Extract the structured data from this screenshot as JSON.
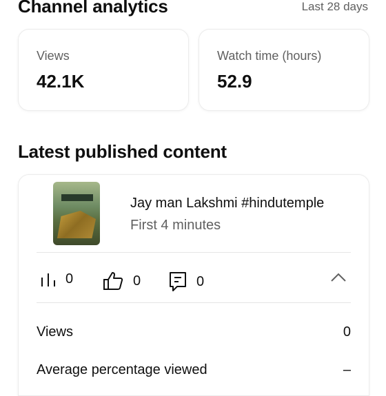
{
  "header": {
    "title": "Channel analytics",
    "range": "Last 28 days"
  },
  "stats": [
    {
      "label": "Views",
      "value": "42.1K"
    },
    {
      "label": "Watch time (hours)",
      "value": "52.9"
    }
  ],
  "latest": {
    "title": "Latest published content",
    "video": {
      "title": "Jay man Lakshmi #hindutemple",
      "subtitle": "First 4 minutes",
      "metrics": {
        "views": "0",
        "likes": "0",
        "comments": "0"
      },
      "details": [
        {
          "label": "Views",
          "value": "0"
        },
        {
          "label": "Average percentage viewed",
          "value": "–"
        }
      ]
    }
  },
  "colors": {
    "text": "#0f0f0f",
    "secondary": "#606060",
    "border": "#ececec"
  },
  "icons": [
    "bar-chart-icon",
    "thumbs-up-icon",
    "comment-icon",
    "chevron-up-icon"
  ]
}
